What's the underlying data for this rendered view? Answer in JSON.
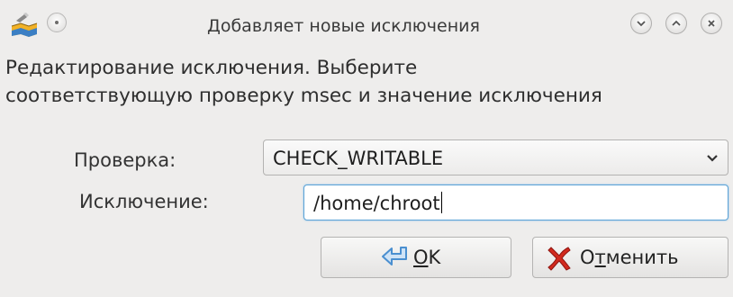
{
  "window": {
    "title": "Добавляет новые исключения"
  },
  "icons": {
    "app": "msec-app-icon",
    "pin": "pin-icon",
    "minimize": "chevron-down-icon",
    "maximize": "chevron-up-icon",
    "close": "close-icon",
    "ok": "ok-arrow-icon",
    "cancel": "red-x-icon"
  },
  "description": {
    "line1": "Редактирование исключения. Выберите",
    "line2": "соответствующую проверку msec и значение исключения"
  },
  "form": {
    "check_label": "Проверка:",
    "check_value": "CHECK_WRITABLE",
    "exception_label": "Исключение:",
    "exception_value": "/home/chroot"
  },
  "buttons": {
    "ok_mnemonic": "O",
    "ok_rest": "K",
    "cancel_pre": "О",
    "cancel_mnemonic": "т",
    "cancel_rest": "менить"
  },
  "colors": {
    "background": "#eeedec",
    "focus_border": "#5aa2d6",
    "cancel_icon": "#d22a1e",
    "ok_icon": "#4a8fd0"
  }
}
